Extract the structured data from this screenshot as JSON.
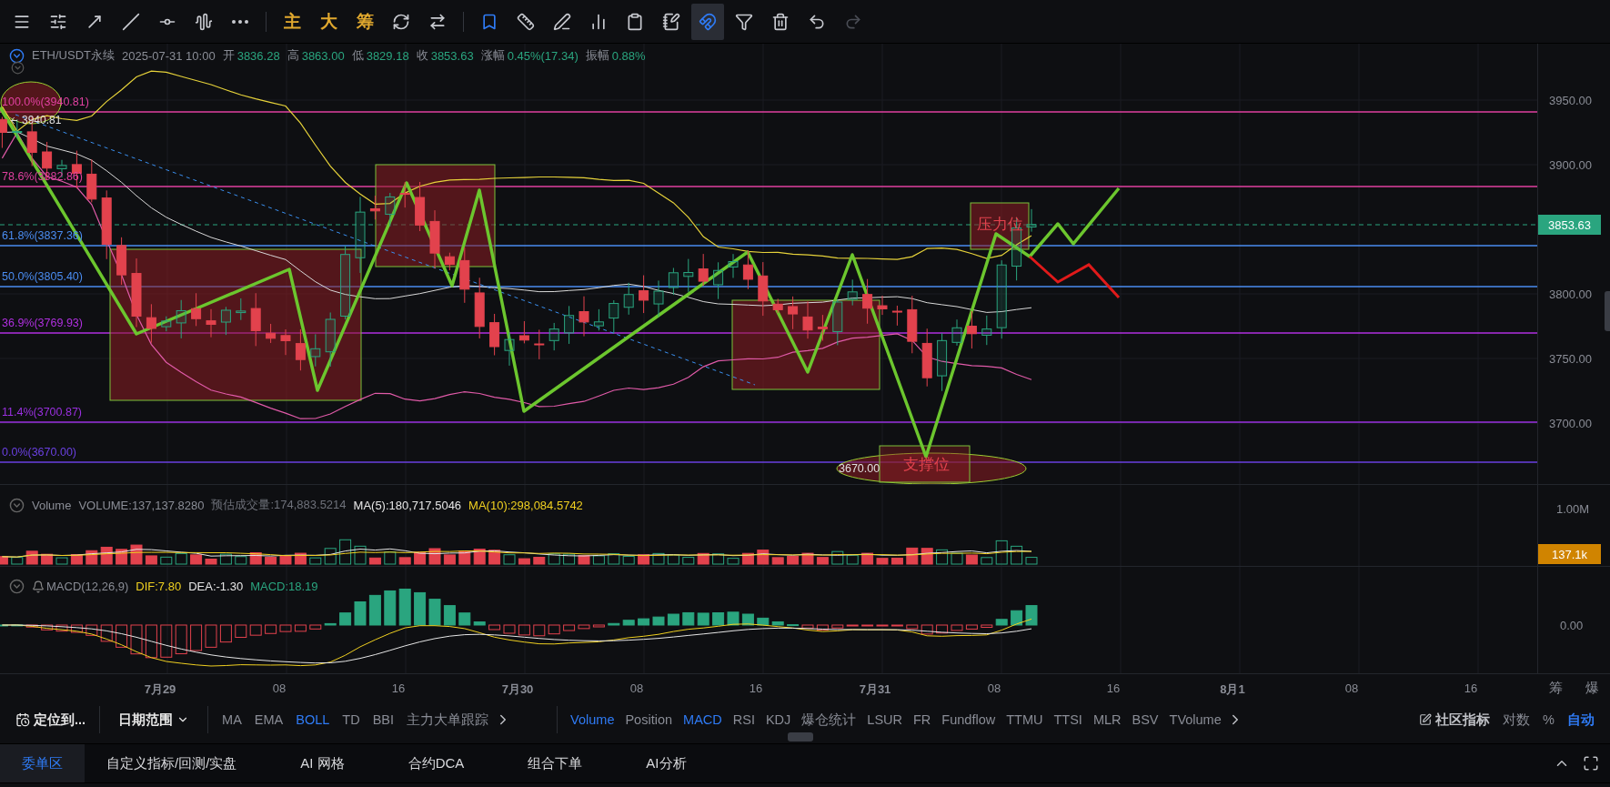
{
  "toolbar": {
    "tools": [
      {
        "kind": "icon",
        "selected": false,
        "disabled": false
      },
      {
        "kind": "icon",
        "selected": false,
        "disabled": false
      },
      {
        "kind": "icon",
        "selected": false,
        "disabled": false
      },
      {
        "kind": "icon",
        "selected": false,
        "disabled": false
      },
      {
        "kind": "icon",
        "selected": false,
        "disabled": false
      },
      {
        "kind": "icon",
        "selected": false,
        "disabled": false
      },
      {
        "kind": "icon",
        "selected": false,
        "disabled": false
      },
      {
        "kind": "separator"
      },
      {
        "kind": "text",
        "label": "主",
        "selected": false,
        "disabled": false
      },
      {
        "kind": "text",
        "label": "大",
        "selected": false,
        "disabled": false
      },
      {
        "kind": "text",
        "label": "筹",
        "selected": false,
        "disabled": false
      },
      {
        "kind": "icon",
        "selected": false,
        "disabled": false
      },
      {
        "kind": "icon",
        "selected": false,
        "disabled": false
      },
      {
        "kind": "separator"
      },
      {
        "kind": "icon",
        "selected": false,
        "disabled": false
      },
      {
        "kind": "icon",
        "selected": false,
        "disabled": false
      },
      {
        "kind": "icon",
        "selected": false,
        "disabled": false
      },
      {
        "kind": "icon",
        "selected": false,
        "disabled": false
      },
      {
        "kind": "icon",
        "selected": false,
        "disabled": false
      },
      {
        "kind": "icon",
        "selected": false,
        "disabled": false
      },
      {
        "kind": "icon",
        "selected": true,
        "disabled": false
      },
      {
        "kind": "icon",
        "selected": false,
        "disabled": false
      },
      {
        "kind": "icon",
        "selected": false,
        "disabled": false
      },
      {
        "kind": "icon",
        "selected": false,
        "disabled": false
      },
      {
        "kind": "icon",
        "selected": false,
        "disabled": true
      }
    ]
  },
  "symbol_bar": {
    "symbol": "ETH/USDT永续",
    "time": "2025-07-31 10:00",
    "fields": [
      {
        "label": "开",
        "value": "3836.28"
      },
      {
        "label": "高",
        "value": "3863.00"
      },
      {
        "label": "低",
        "value": "3829.18"
      },
      {
        "label": "收",
        "value": "3853.63"
      },
      {
        "label": "涨幅",
        "value": "0.45%(17.34)"
      },
      {
        "label": "振幅",
        "value": "0.88%"
      }
    ]
  },
  "main_chart": {
    "fib_levels": [
      {
        "label": "100.0%(3940.81)",
        "color": "#e040a0"
      },
      {
        "label": "78.6%(3882.86)",
        "color": "#e040a0"
      },
      {
        "label": "61.8%(3837.36)",
        "color": "#4a8cf0"
      },
      {
        "label": "50.0%(3805.40)",
        "color": "#4a8cf0"
      },
      {
        "label": "36.9%(3769.93)",
        "color": "#b030e0"
      },
      {
        "label": "11.4%(3700.87)",
        "color": "#9a30e0"
      },
      {
        "label": "0.0%(3670.00)",
        "color": "#6a40e0"
      }
    ],
    "price_ticks": [
      "3950.00",
      "3900.00",
      "3800.00",
      "3750.00",
      "3700.00"
    ],
    "last_price": "3853.63",
    "high_marker": "3940.81",
    "low_marker": "3670.00",
    "resistance_label": "压力位",
    "support_label": "支撑位"
  },
  "volume_pane": {
    "title": "Volume",
    "items": [
      {
        "text": "VOLUME:137,137.8280",
        "color": "#8a8d96"
      },
      {
        "text": "预估成交量:174,883.5214",
        "color": "#6e717a"
      },
      {
        "text": "MA(5):180,717.5046",
        "color": "#e6e6e6"
      },
      {
        "text": "MA(10):298,084.5742",
        "color": "#f0d020"
      }
    ],
    "ticks": [
      "1.00M"
    ],
    "last_value": "137.1k"
  },
  "macd_pane": {
    "title": "MACD(12,26,9)",
    "items": [
      {
        "text": "DIF:7.80",
        "color": "#f0d020"
      },
      {
        "text": "DEA:-1.30",
        "color": "#e6e6e6"
      },
      {
        "text": "MACD:18.19",
        "color": "#2aa57f"
      }
    ],
    "ticks": [
      "0.00"
    ]
  },
  "time_axis": {
    "labels": [
      {
        "text": "7月29",
        "kind": "date"
      },
      {
        "text": "08",
        "kind": "hour"
      },
      {
        "text": "16",
        "kind": "hour"
      },
      {
        "text": "7月30",
        "kind": "date"
      },
      {
        "text": "08",
        "kind": "hour"
      },
      {
        "text": "16",
        "kind": "hour"
      },
      {
        "text": "7月31",
        "kind": "date"
      },
      {
        "text": "08",
        "kind": "hour"
      },
      {
        "text": "16",
        "kind": "hour"
      },
      {
        "text": "8月1",
        "kind": "date"
      },
      {
        "text": "08",
        "kind": "hour"
      },
      {
        "text": "16",
        "kind": "hour"
      }
    ],
    "side_buttons": [
      "筹",
      "爆"
    ]
  },
  "indicator_bar": {
    "locate": "定位到...",
    "date_range": "日期范围",
    "main_indicators": [
      {
        "label": "MA",
        "selected": false
      },
      {
        "label": "EMA",
        "selected": false
      },
      {
        "label": "BOLL",
        "selected": true
      },
      {
        "label": "TD",
        "selected": false
      },
      {
        "label": "BBI",
        "selected": false
      },
      {
        "label": "主力大单跟踪",
        "selected": false
      }
    ],
    "sub_indicators": [
      {
        "label": "Volume",
        "selected": true
      },
      {
        "label": "Position",
        "selected": false
      },
      {
        "label": "MACD",
        "selected": true
      },
      {
        "label": "RSI",
        "selected": false
      },
      {
        "label": "KDJ",
        "selected": false
      },
      {
        "label": "爆仓统计",
        "selected": false
      },
      {
        "label": "LSUR",
        "selected": false
      },
      {
        "label": "FR",
        "selected": false
      },
      {
        "label": "Fundflow",
        "selected": false
      },
      {
        "label": "TTMU",
        "selected": false
      },
      {
        "label": "TTSI",
        "selected": false
      },
      {
        "label": "MLR",
        "selected": false
      },
      {
        "label": "BSV",
        "selected": false
      },
      {
        "label": "TVolume",
        "selected": false
      }
    ],
    "community": "社区指标",
    "scale_options": [
      {
        "label": "对数",
        "selected": false
      },
      {
        "label": "%",
        "selected": false
      },
      {
        "label": "自动",
        "selected": true
      }
    ]
  },
  "bottom_tabs": [
    {
      "label": "委单区",
      "selected": true
    },
    {
      "label": "自定义指标/回测/实盘",
      "selected": false
    },
    {
      "label": "AI 网格",
      "selected": false
    },
    {
      "label": "合约DCA",
      "selected": false
    },
    {
      "label": "组合下单",
      "selected": false
    },
    {
      "label": "AI分析",
      "selected": false
    }
  ]
}
